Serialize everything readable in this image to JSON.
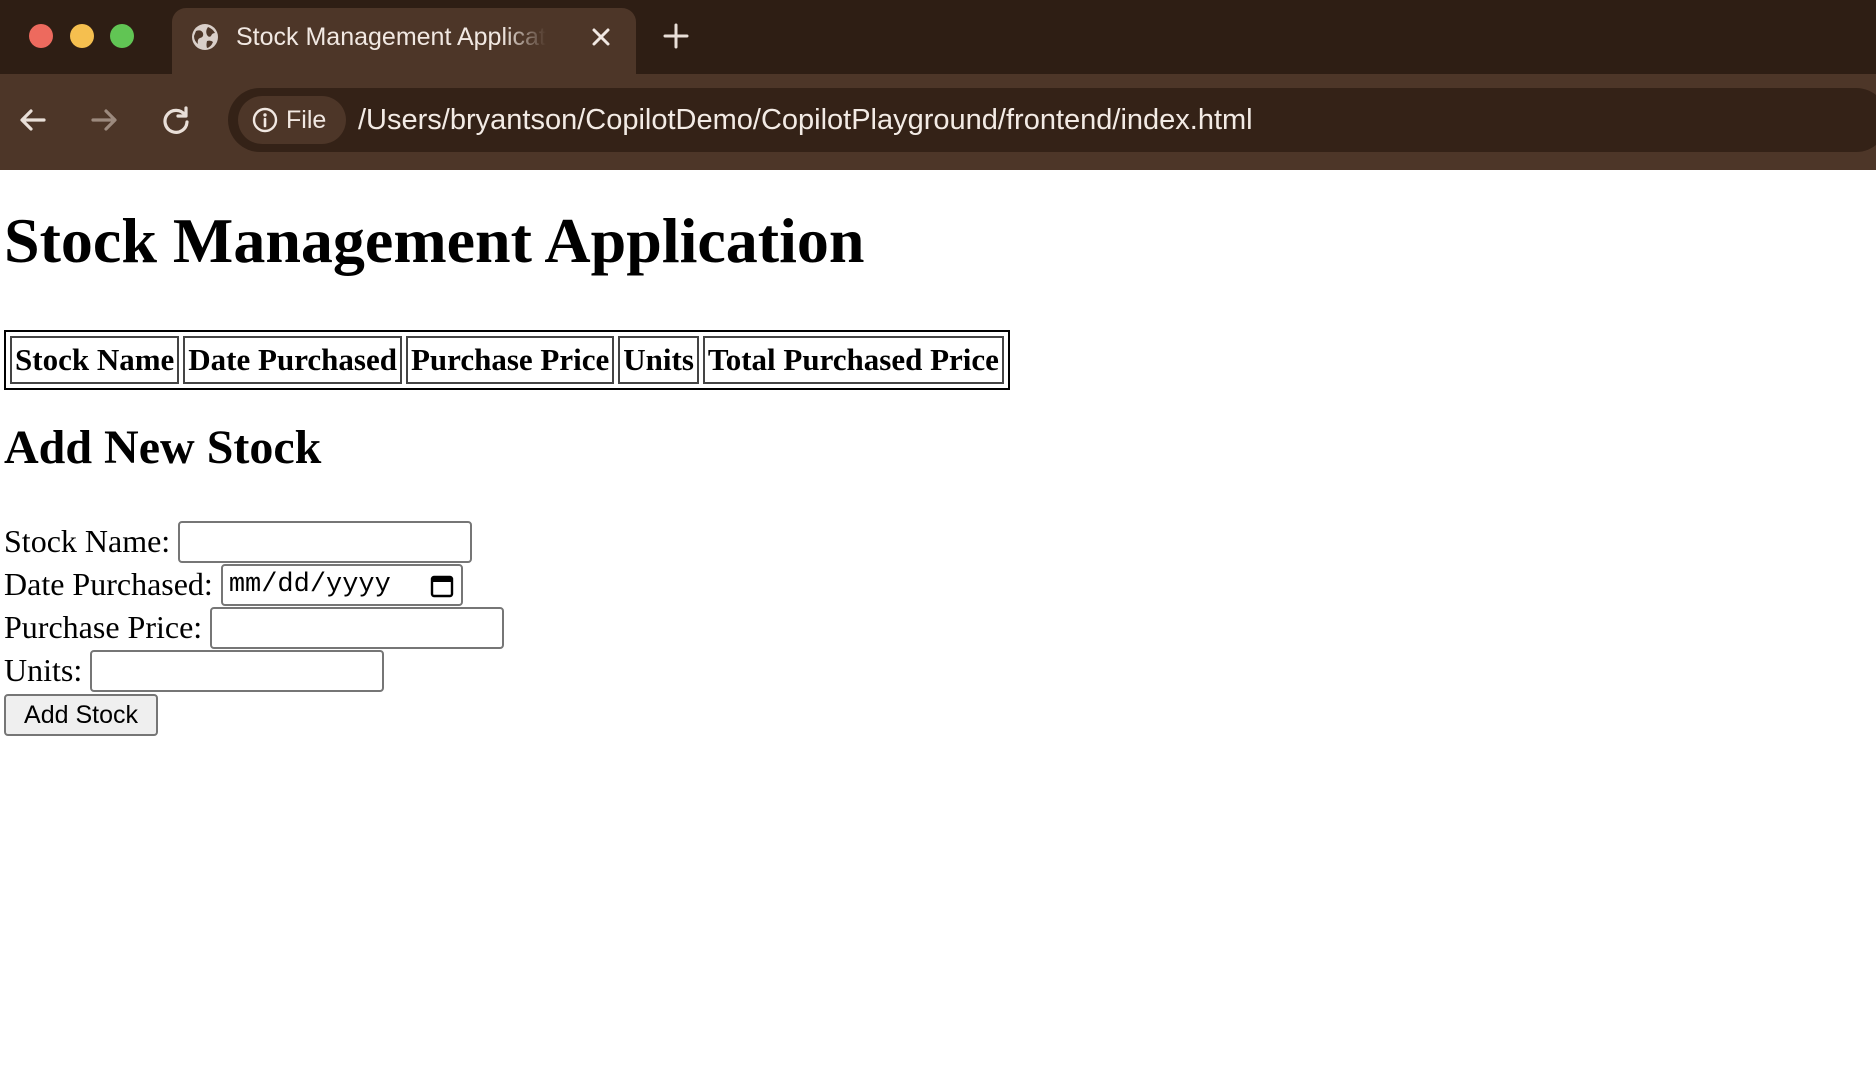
{
  "browser": {
    "tab": {
      "title": "Stock Management Application",
      "icon": "globe-icon"
    },
    "address_bar": {
      "scheme_chip_label": "File",
      "scheme_chip_icon": "info-icon",
      "url": "/Users/bryantson/CopilotDemo/CopilotPlayground/frontend/index.html"
    },
    "colors": {
      "tabbar": "#2e1e14",
      "toolbar": "#4d3628",
      "omnibox": "#342217"
    }
  },
  "page": {
    "title": "Stock Management Application",
    "table": {
      "headers": [
        "Stock Name",
        "Date Purchased",
        "Purchase Price",
        "Units",
        "Total Purchased Price"
      ]
    },
    "form": {
      "heading": "Add New Stock",
      "fields": {
        "stock_name": {
          "label": "Stock Name:",
          "value": ""
        },
        "date_purchased": {
          "label": "Date Purchased:",
          "placeholder": "mm/dd/yyyy",
          "value": ""
        },
        "purchase_price": {
          "label": "Purchase Price:",
          "value": ""
        },
        "units": {
          "label": "Units:",
          "value": ""
        }
      },
      "submit_label": "Add Stock"
    }
  }
}
